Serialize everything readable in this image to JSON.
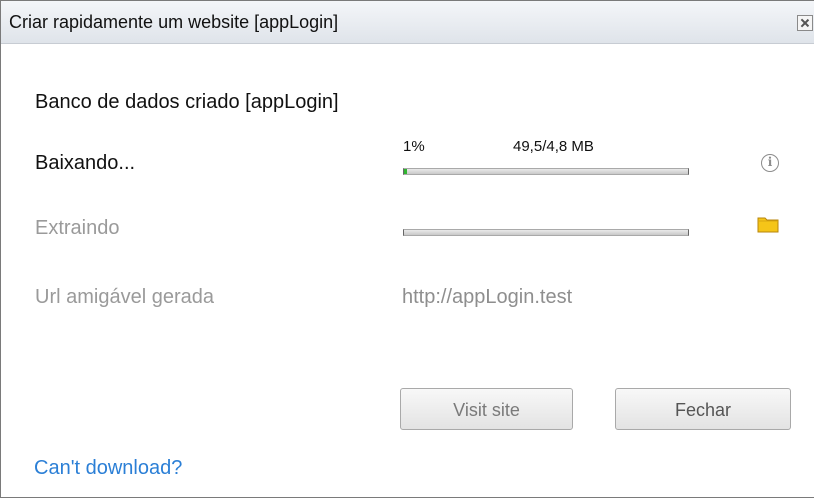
{
  "window": {
    "title": "Criar rapidamente um website [appLogin]"
  },
  "status": {
    "heading": "Banco de dados criado [appLogin]"
  },
  "download": {
    "label": "Baixando...",
    "percent_text": "1%",
    "size_text": "49,5/4,8 MB",
    "progress_fraction": 0.01,
    "icon": "info-icon"
  },
  "extract": {
    "label": "Extraindo",
    "progress_fraction": 0.0,
    "icon": "folder-icon"
  },
  "url": {
    "label": "Url amigável gerada",
    "value": "http://appLogin.test"
  },
  "buttons": {
    "visit_label": "Visit site",
    "close_label": "Fechar"
  },
  "footer": {
    "link_text": "Can't download?"
  },
  "colors": {
    "progress_fill": "#2fb52f",
    "link": "#2b7fd6",
    "folder": "#f5c518"
  }
}
